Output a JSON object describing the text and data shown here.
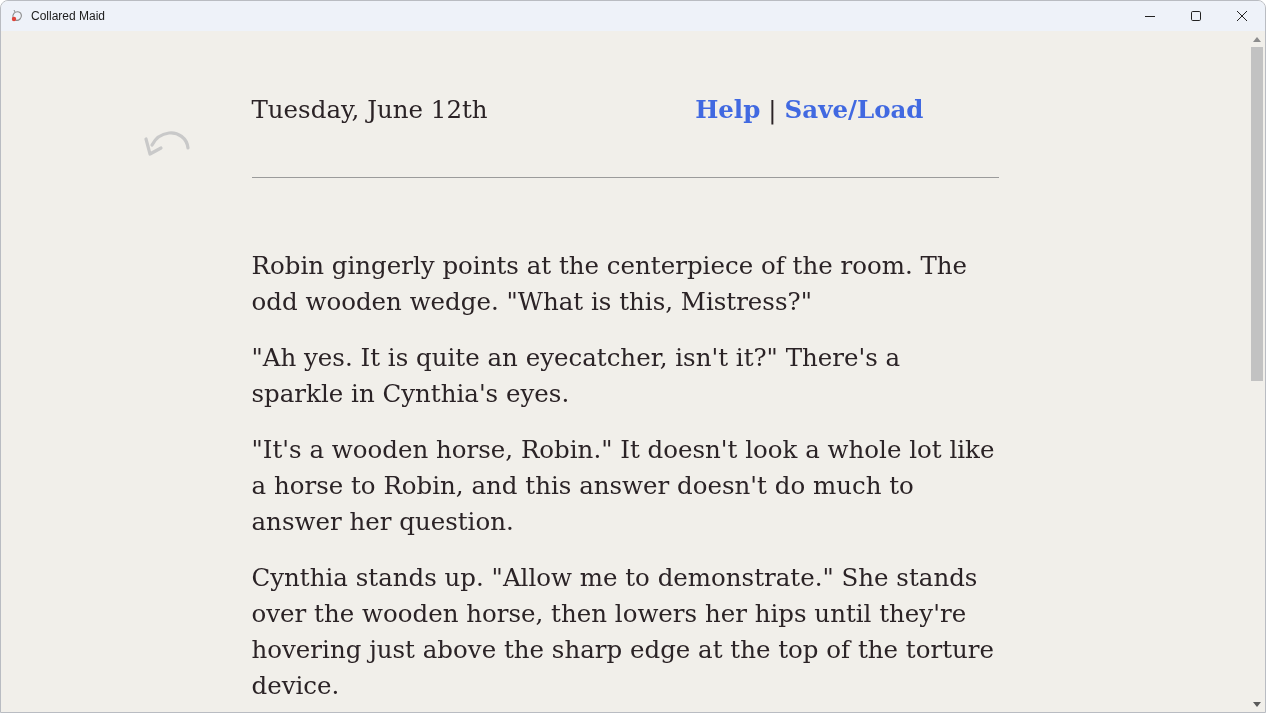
{
  "window": {
    "title": "Collared Maid"
  },
  "header": {
    "date": "Tuesday, June 12th",
    "links": [
      {
        "label": "Help"
      },
      {
        "label": "Save/Load"
      }
    ],
    "separator": "|"
  },
  "story": {
    "paragraphs": [
      "Robin gingerly points at the centerpiece of the room. The odd wooden wedge. \"What is this, Mistress?\"",
      "\"Ah yes. It is quite an eyecatcher, isn't it?\" There's a sparkle in Cynthia's eyes.",
      "\"It's a wooden horse, Robin.\" It doesn't look a whole lot like a horse to Robin, and this answer doesn't do much to answer her question.",
      "Cynthia stands up. \"Allow me to demonstrate.\" She stands over the wooden horse, then lowers her hips until they're hovering just above the sharp edge at the top of the torture device."
    ]
  }
}
